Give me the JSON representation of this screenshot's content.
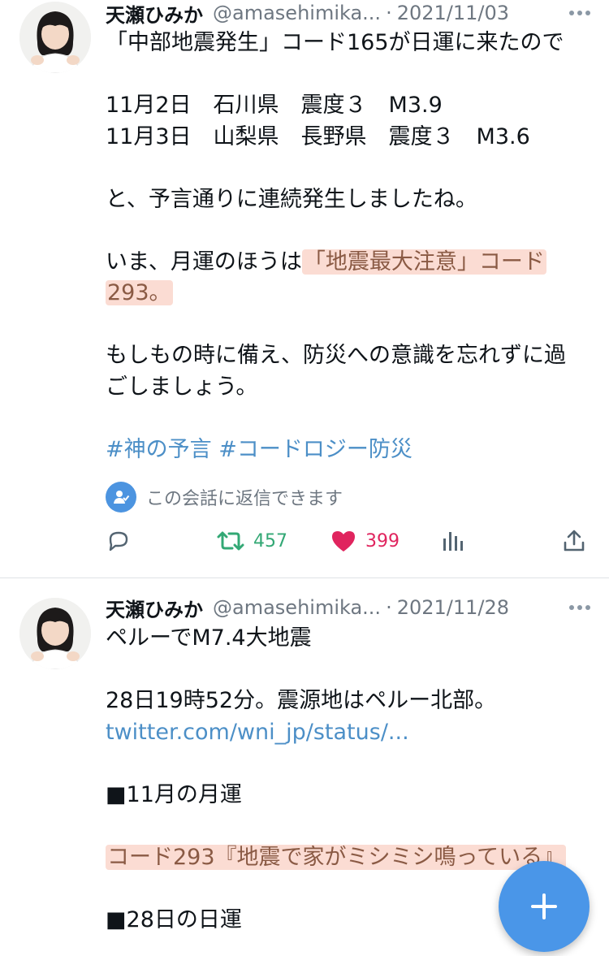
{
  "tweets": [
    {
      "author_name": "天瀬ひみか",
      "handle": "@amasehimika...",
      "separator": "·",
      "date": "2021/11/03",
      "line1": "「中部地震発生」コード165が日運に来たので",
      "line2": "11月2日　石川県　震度３　M3.9",
      "line3": "11月3日　山梨県　長野県　震度３　M3.6",
      "line4": "と、予言通りに連続発生しましたね。",
      "line5_prefix": "いま、月運のほうは",
      "line5_highlight": "「地震最大注意」コード",
      "line6_highlight": "293。",
      "line7": "もしもの時に備え、防災への意識を忘れずに過",
      "line8": "ごしましょう。",
      "hashtags": "#神の予言 #コードロジー防災",
      "reply_info": "この会話に返信できます",
      "retweets": "457",
      "likes": "399"
    },
    {
      "author_name": "天瀬ひみか",
      "handle": "@amasehimika...",
      "separator": "·",
      "date": "2021/11/28",
      "line1": "ペルーでM7.4大地震",
      "line2": "28日19時52分。震源地はペルー北部。",
      "link": "twitter.com/wni_jp/status/...",
      "line3": "■11月の月運",
      "line4_highlight": "コード293『地震で家がミシミシ鳴っている』",
      "line5": "■28日の日運"
    }
  ],
  "colors": {
    "accent": "#4c8fc7",
    "retweet": "#33a875",
    "like": "#e0245e",
    "highlight_bg": "#fbdcd3",
    "fab": "#4a96e8"
  },
  "icons": [
    "more-icon",
    "reply-icon",
    "retweet-icon",
    "like-icon",
    "stats-icon",
    "share-icon",
    "reply-permission-icon",
    "compose-plus-icon"
  ]
}
